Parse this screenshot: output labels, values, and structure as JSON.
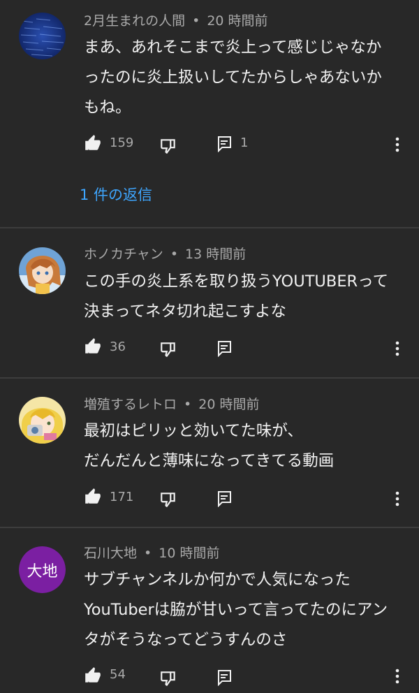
{
  "colors": {
    "background": "#282828",
    "text": "#f1f1f1",
    "muted": "#aaaaaa",
    "link": "#3ea6ff",
    "divider": "#3d3d3d"
  },
  "comments": [
    {
      "author": "2月生まれの人間",
      "time": "20 時間前",
      "lines": [
        "まあ、あれそこまで炎上って感じじゃなか",
        "ったのに炎上扱いしてたからしゃあないか",
        "もね。"
      ],
      "likes": "159",
      "reply_count": "1",
      "replies_link": "1 件の返信",
      "avatar": "blue-noise"
    },
    {
      "author": "ホノカチャン",
      "time": "13 時間前",
      "lines": [
        "この手の炎上系を取り扱うYOUTUBERって",
        "決まってネタ切れ起こすよな"
      ],
      "likes": "36",
      "reply_count": "",
      "avatar": "anime-girl"
    },
    {
      "author": "増殖するレトロ",
      "time": "20 時間前",
      "lines": [
        "最初はピリッと効いてた味が、",
        "だんだんと薄味になってきてる動画"
      ],
      "likes": "171",
      "reply_count": "",
      "avatar": "anime-blonde"
    },
    {
      "author": "石川大地",
      "time": "10 時間前",
      "lines": [
        "サブチャンネルか何かで人気になった",
        "YouTuberは脇が甘いって言ってたのにアン",
        "タがそうなってどうすんのさ"
      ],
      "likes": "54",
      "reply_count": "",
      "avatar_text": "大地",
      "avatar_color": "#7b1fa2"
    }
  ]
}
